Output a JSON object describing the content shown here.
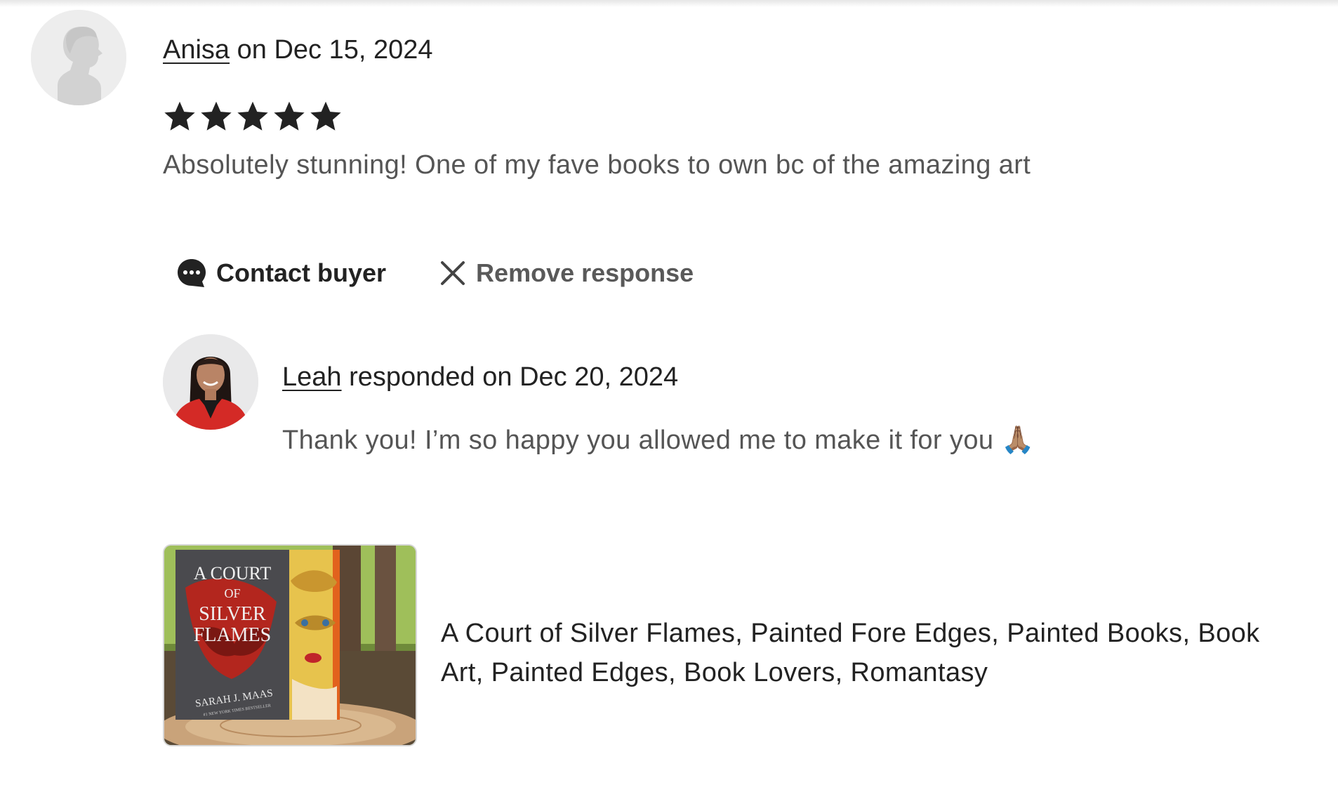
{
  "review": {
    "reviewer_name": "Anisa",
    "date_text": " on Dec 15, 2024",
    "rating": 5,
    "max_rating": 5,
    "text": "Absolutely stunning! One of my fave books to own bc of the amazing art"
  },
  "actions": {
    "contact_label": "Contact buyer",
    "remove_label": "Remove response"
  },
  "response": {
    "seller_name": "Leah",
    "date_text": " responded on Dec 20, 2024",
    "text": "Thank you! I’m so happy you allowed me to make it for you 🙏🏽"
  },
  "listing": {
    "title": "A Court of Silver Flames, Painted Fore Edges, Painted Books, Book Art, Painted Edges, Book Lovers, Romantasy",
    "cover_title_line1": "A COURT",
    "cover_title_line2": "OF",
    "cover_title_line3": "SILVER",
    "cover_title_line4": "FLAMES",
    "cover_author": "SARAH J. MAAS",
    "cover_tagline": "#1 NEW YORK TIMES BESTSELLER"
  },
  "colors": {
    "star": "#222222",
    "text_primary": "#222222",
    "text_secondary": "#555555"
  },
  "icons": {
    "star": "star-icon",
    "contact": "chat-bubble-icon",
    "remove": "close-icon"
  }
}
